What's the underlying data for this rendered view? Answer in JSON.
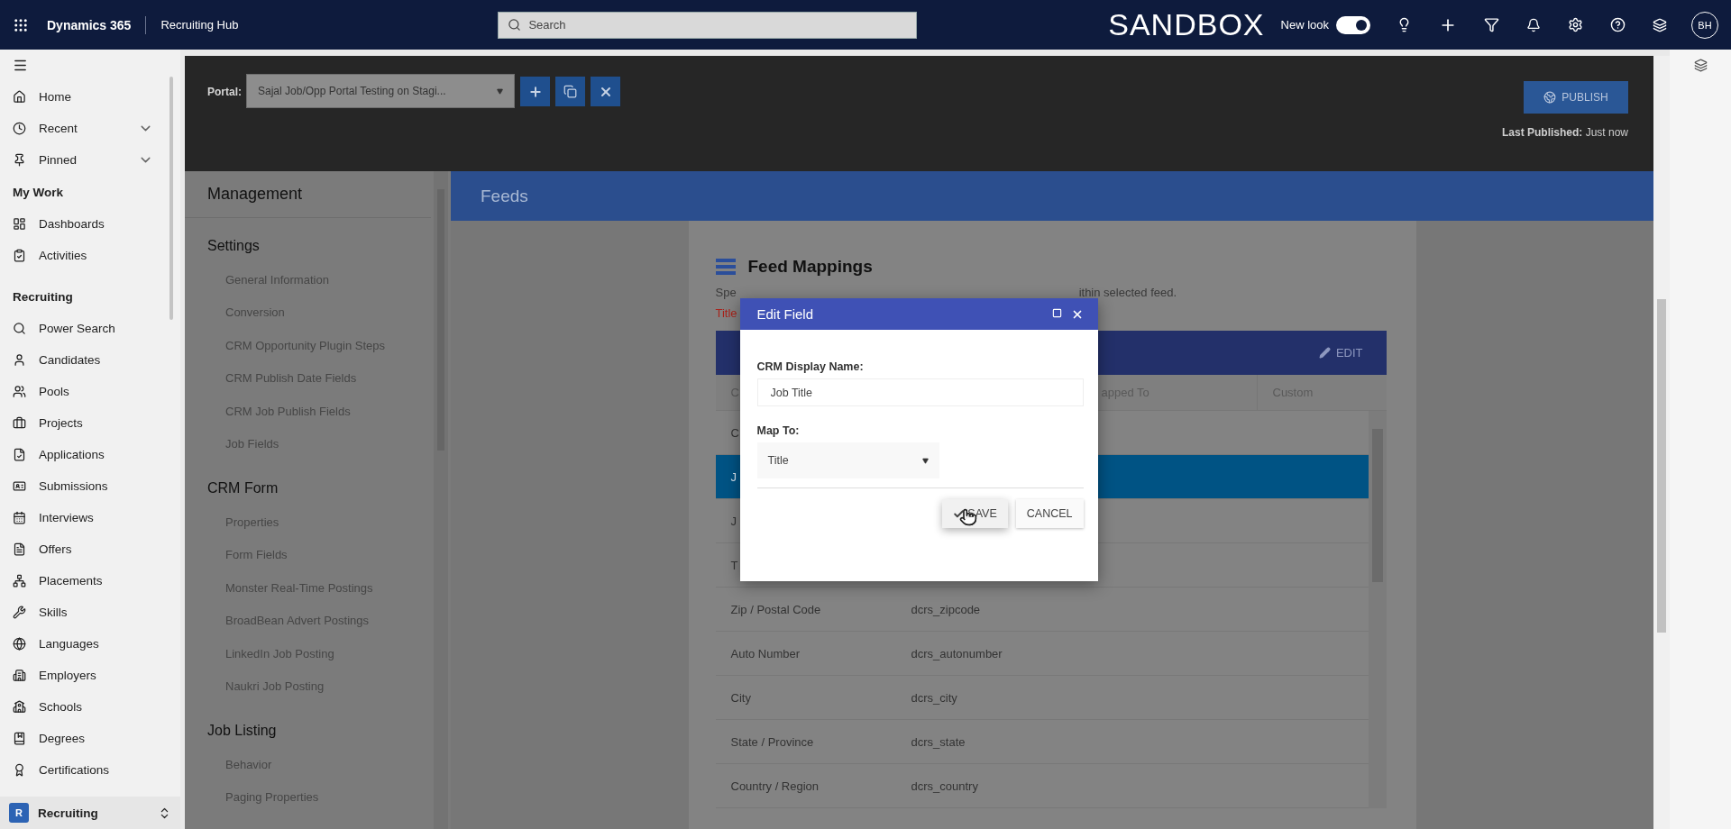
{
  "app_bar": {
    "app_name": "Dynamics 365",
    "area": "Recruiting Hub",
    "search": {
      "placeholder": "Search"
    },
    "environment": "SANDBOX",
    "new_look": {
      "label": "New look",
      "on": true
    },
    "avatar": "BH"
  },
  "sidebar": {
    "top": [
      {
        "label": "Home",
        "kind": "link"
      },
      {
        "label": "Recent",
        "kind": "flyout"
      },
      {
        "label": "Pinned",
        "kind": "flyout"
      }
    ],
    "groups": [
      {
        "title": "My Work",
        "items": [
          "Dashboards",
          "Activities"
        ]
      },
      {
        "title": "Recruiting",
        "items": [
          "Power Search",
          "Candidates",
          "Pools",
          "Projects",
          "Applications",
          "Submissions",
          "Interviews",
          "Offers",
          "Placements",
          "Skills",
          "Languages",
          "Employers",
          "Schools",
          "Degrees",
          "Certifications"
        ]
      }
    ],
    "area_switcher": {
      "badge": "R",
      "label": "Recruiting"
    }
  },
  "portal_bar": {
    "label": "Portal:",
    "value": "Sajal Job/Opp Portal Testing on Stagi...",
    "publish": "PUBLISH",
    "last_published": "**Last Published:** Just now"
  },
  "management": {
    "title": "Management",
    "sections": [
      {
        "title": "Settings",
        "items": [
          "General Information",
          "Conversion",
          "CRM Opportunity Plugin Steps",
          "CRM Publish Date Fields",
          "CRM Job Publish Fields",
          "Job Fields"
        ]
      },
      {
        "title": "CRM Form",
        "items": [
          "Properties",
          "Form Fields",
          "Monster Real-Time Postings",
          "BroadBean Advert Postings",
          "LinkedIn Job Posting",
          "Naukri Job Posting"
        ]
      },
      {
        "title": "Job Listing",
        "items": [
          "Behavior",
          "Paging Properties"
        ]
      }
    ]
  },
  "page_header": {
    "title": "Feeds"
  },
  "feed_mappings": {
    "title": "Feed Mappings",
    "description_parts": [
      "Spe",
      "ithin selected feed."
    ],
    "note": "Title",
    "table": {
      "edit": "EDIT",
      "columns": [
        "C",
        "apped To",
        "Custom"
      ],
      "rows": [
        {
          "name": "C",
          "selected": false
        },
        {
          "name": "J",
          "selected": true
        },
        {
          "name": "J",
          "selected": false
        },
        {
          "name": "T",
          "selected": false
        },
        {
          "name": "Zip / Postal Code",
          "mapped_to": "dcrs_zipcode",
          "selected": false
        },
        {
          "name": "Auto Number",
          "mapped_to": "dcrs_autonumber",
          "selected": false
        },
        {
          "name": "City",
          "mapped_to": "dcrs_city",
          "selected": false
        },
        {
          "name": "State / Province",
          "mapped_to": "dcrs_state",
          "selected": false
        },
        {
          "name": "Country / Region",
          "mapped_to": "dcrs_country",
          "selected": false
        }
      ]
    }
  },
  "dialog": {
    "title": "Edit Field",
    "display_name": {
      "label": "CRM Display Name:",
      "value": "Job Title"
    },
    "map_to": {
      "label": "Map To:",
      "value": "Title"
    },
    "save": "SAVE",
    "cancel": "CANCEL"
  }
}
